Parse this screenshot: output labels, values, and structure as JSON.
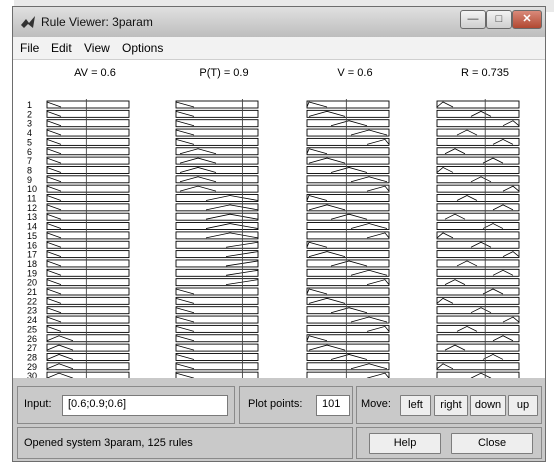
{
  "window": {
    "title": "Rule Viewer: 3param"
  },
  "menu": [
    "File",
    "Edit",
    "View",
    "Options"
  ],
  "columns": [
    {
      "title": "AV = 0.6",
      "input_value": 0.6
    },
    {
      "title": "P(T) = 0.9",
      "input_value": 0.9
    },
    {
      "title": "V = 0.6",
      "input_value": 0.6
    },
    {
      "title": "R = 0.735",
      "output_value": 0.735
    }
  ],
  "visible_rule_numbers": [
    "1",
    "2",
    "3",
    "4",
    "5",
    "6",
    "7",
    "8",
    "9",
    "10",
    "11",
    "12",
    "13",
    "14",
    "15",
    "16",
    "17",
    "18",
    "19",
    "20",
    "21",
    "22",
    "23",
    "24",
    "25",
    "26",
    "27",
    "28",
    "29",
    "30"
  ],
  "controls": {
    "input_label": "Input:",
    "input_value": "[0.6;0.9;0.6]",
    "plot_points_label": "Plot points:",
    "plot_points_value": "101",
    "move_label": "Move:",
    "move_buttons": [
      "left",
      "right",
      "down",
      "up"
    ],
    "help_label": "Help",
    "close_label": "Close"
  },
  "status": "Opened system 3param, 125 rules",
  "colors": {
    "window_bg": "#c9c9c9",
    "plot_bg": "#ffffff",
    "close_button": "#b14832"
  }
}
